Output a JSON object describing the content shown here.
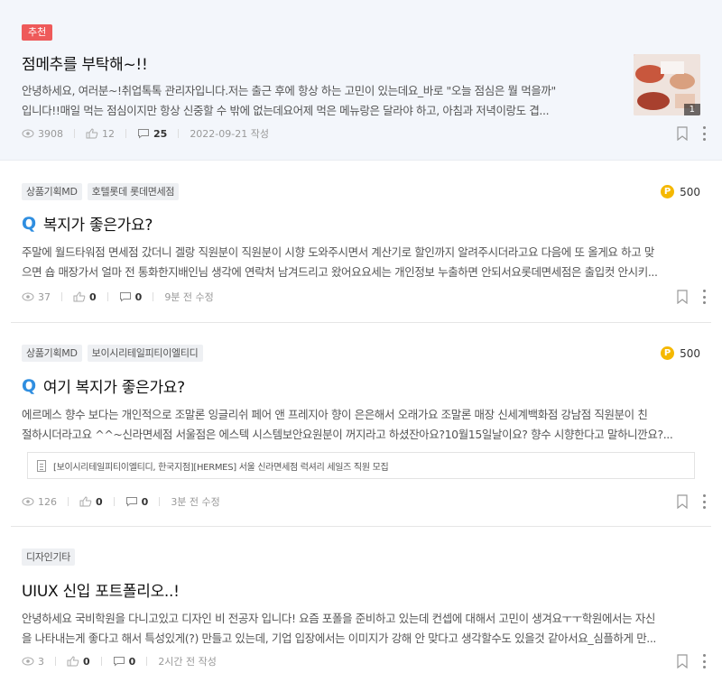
{
  "posts": [
    {
      "badge": "추천",
      "title": "점메추를 부탁해~!!",
      "excerpt_line1": "안녕하세요, 여러분~!취업톡톡 관리자입니다.저는 출근 후에 항상 하는 고민이 있는데요_바로 \"오늘 점심은 뭘 먹을까\"",
      "excerpt_line2": "입니다!!매일 먹는 점심이지만 항상 신중할 수 밖에 없는데요어제 먹은 메뉴랑은 달라야 하고, 아침과 저녁이랑도 겹...",
      "views": "3908",
      "likes": "12",
      "comments": "25",
      "date": "2022-09-21 작성",
      "thumb_count": "1"
    },
    {
      "tags": [
        "상품기획MD",
        "호텔롯데 롯데면세점"
      ],
      "points": "500",
      "q_mark": "Q",
      "title": "복지가 좋은가요?",
      "excerpt_line1": "주말에 월드타워점 면세점 갔더니  겔랑 직원분이 직원분이 시향 도와주시면서 계산기로 할인까지 알려주시더라고요 다음에 또 올게요 하고 맞",
      "excerpt_line2": "으면 숍 매장가서 얼마 전 통화한지배인님 생각에 연락처 남겨드리고 왔어요요세는 개인정보 누출하면 안되서요롯데면세점은 출입컷 안시키...",
      "views": "37",
      "likes": "0",
      "comments": "0",
      "date": "9분 전 수정"
    },
    {
      "tags": [
        "상품기획MD",
        "보이시리테일피티이엘티디"
      ],
      "points": "500",
      "q_mark": "Q",
      "title": "여기 복지가 좋은가요?",
      "excerpt_line1": "에르메스 향수 보다는 개인적으로 조말론 잉글리쉬 페어 앤 프레지아  향이 은은해서 오래가요 조말론 매장 신세계백화점 강남점 직원분이 친",
      "excerpt_line2": "절하시더라고요 ^^~신라면세점 서울점은 에스텍 시스템보안요원분이 꺼지라고 하셨잔아요?10월15일날이요? 향수 시향한다고 말하니깐요?...",
      "attachment": "[보이시리테일피티이엘티디, 한국지점][HERMES] 서울 신라면세점 럭셔리 세일즈 직원 모집",
      "views": "126",
      "likes": "0",
      "comments": "0",
      "date": "3분 전 수정"
    },
    {
      "tags": [
        "디자인기타"
      ],
      "title": "UIUX 신입 포트폴리오..!",
      "excerpt_line1": "안녕하세요 국비학원을 다니고있고 디자인 비 전공자 입니다! 요즘 포폴을 준비하고 있는데 컨셉에 대해서 고민이 생겨요ㅜㅜ학원에서는 자신",
      "excerpt_line2": "을  나타내는게 좋다고 해서 특성있게(?)  만들고 있는데, 기업 입장에서는 이미지가 강해 안 맞다고 생각할수도 있을것 같아서요_심플하게 만...",
      "views": "3",
      "likes": "0",
      "comments": "0",
      "date": "2시간 전 작성"
    }
  ],
  "colors": {
    "badge": "#ee5a5a",
    "q_mark": "#2f8ee0",
    "coin": "#f5b800",
    "featured_bg": "#f3f6fb"
  },
  "icons": [
    "eye-icon",
    "thumbs-up-icon",
    "comment-icon",
    "bookmark-icon",
    "more-icon",
    "point-coin-icon",
    "document-icon"
  ]
}
